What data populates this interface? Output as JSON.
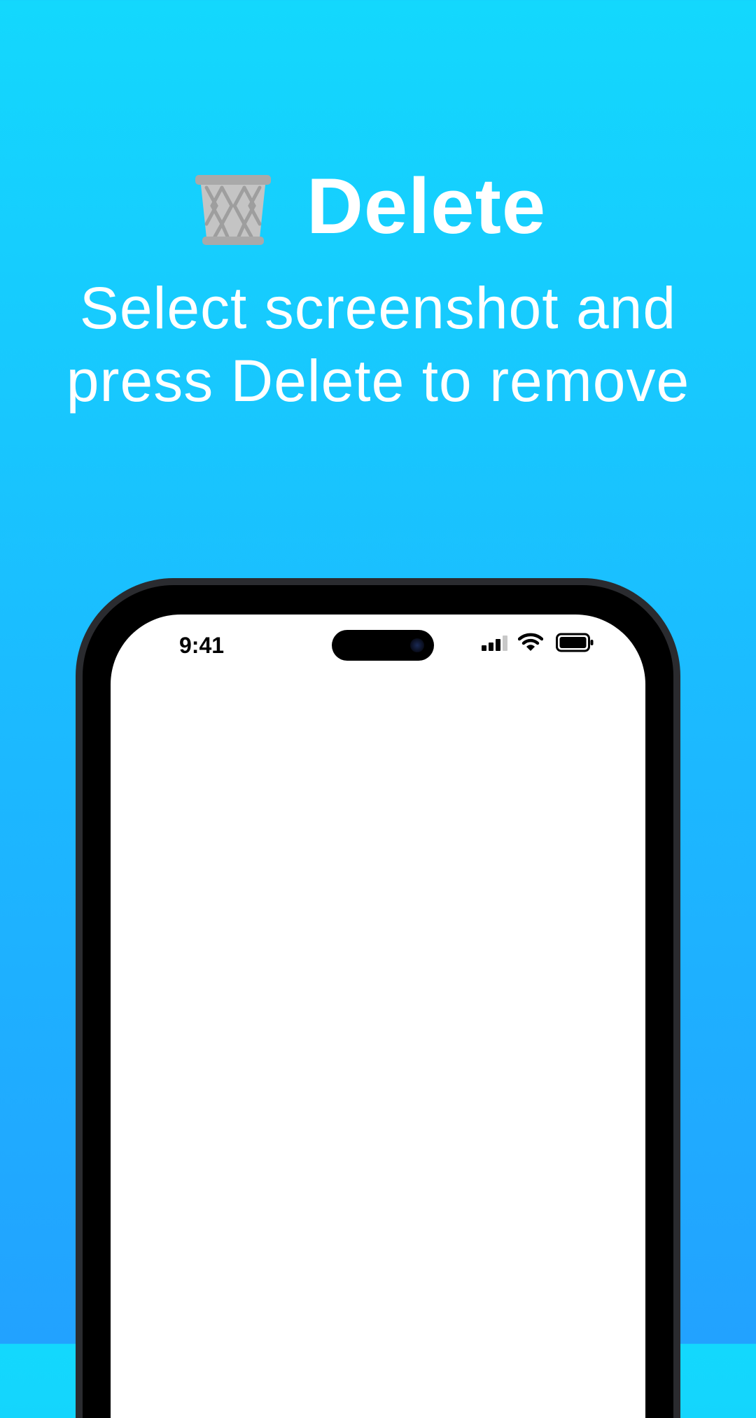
{
  "header": {
    "icon": "wastebasket-icon",
    "title": "Delete",
    "subtitle_lines": [
      "Select screenshot and",
      "press Delete to remove"
    ]
  },
  "phone": {
    "status_bar": {
      "time": "9:41",
      "icons": [
        "cellular-signal-icon",
        "wifi-icon",
        "battery-icon"
      ]
    }
  },
  "colors": {
    "background_top": "#13d8fd",
    "background_bottom": "#22a2ff",
    "text": "#ffffff",
    "phone_frame": "#2a2b2f",
    "screen": "#ffffff"
  }
}
